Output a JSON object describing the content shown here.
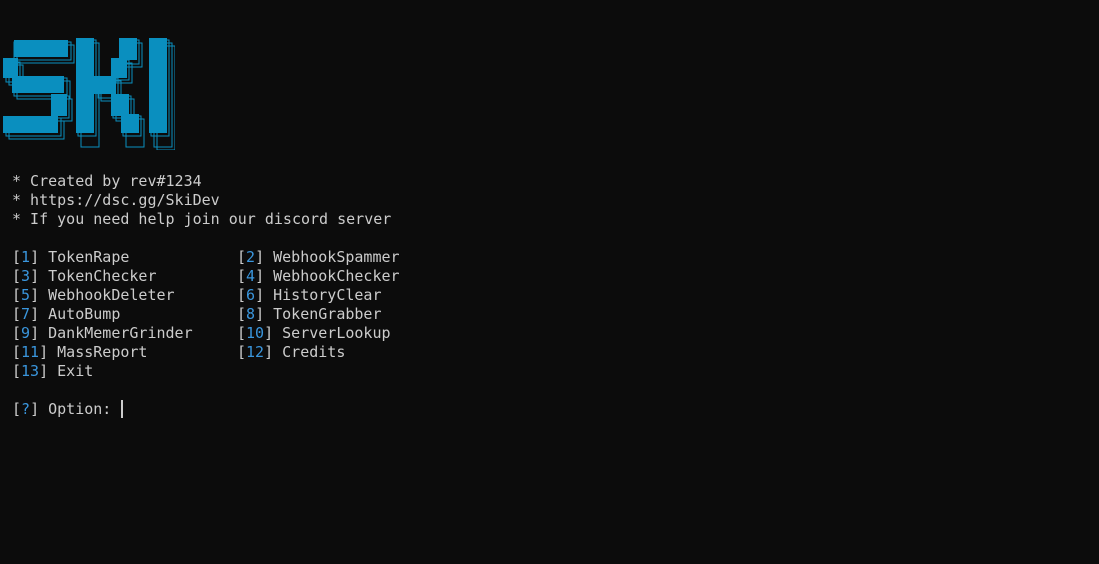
{
  "colors": {
    "background": "#0c0c0c",
    "text": "#cccccc",
    "accent": "#3a96dd",
    "logo": "#0a8fbf"
  },
  "logo": {
    "text": "SKI"
  },
  "info": [
    "* Created by rev#1234",
    "* https://dsc.gg/SkiDev",
    "* If you need help join our discord server"
  ],
  "menu": [
    {
      "num": "1",
      "label": "TokenRape"
    },
    {
      "num": "2",
      "label": "WebhookSpammer"
    },
    {
      "num": "3",
      "label": "TokenChecker"
    },
    {
      "num": "4",
      "label": "WebhookChecker"
    },
    {
      "num": "5",
      "label": "WebhookDeleter"
    },
    {
      "num": "6",
      "label": "HistoryClear"
    },
    {
      "num": "7",
      "label": "AutoBump"
    },
    {
      "num": "8",
      "label": "TokenGrabber"
    },
    {
      "num": "9",
      "label": "DankMemerGrinder"
    },
    {
      "num": "10",
      "label": "ServerLookup"
    },
    {
      "num": "11",
      "label": "MassReport"
    },
    {
      "num": "12",
      "label": "Credits"
    },
    {
      "num": "13",
      "label": "Exit"
    }
  ],
  "prompt": {
    "symbol": "?",
    "label": "Option:"
  }
}
